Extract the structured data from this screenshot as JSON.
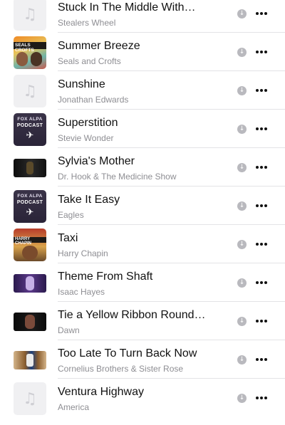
{
  "icons": {
    "download": "download-arrow-circle-icon",
    "more": "more-ellipsis-icon",
    "placeholder": "music-note-icon",
    "podcast_plane": "airplane-icon"
  },
  "colors": {
    "title_text": "#111111",
    "artist_text": "#8e8e93",
    "download_icon": "#b9b9be",
    "separator": "#e3e3e6"
  },
  "songs": [
    {
      "title": "Stuck In The Middle With…",
      "artist": "Stealers Wheel",
      "art": "placeholder"
    },
    {
      "title": "Summer Breeze",
      "artist": "Seals and Crofts",
      "art": "seals",
      "art_text": "SEALS CROFTS"
    },
    {
      "title": "Sunshine",
      "artist": "Jonathan Edwards",
      "art": "placeholder"
    },
    {
      "title": "Superstition",
      "artist": "Stevie Wonder",
      "art": "podcast",
      "art_text_1": "FOX ALPA",
      "art_text_2": "PODCAST"
    },
    {
      "title": "Sylvia's Mother",
      "artist": "Dr. Hook & The Medicine Show",
      "art": "mother"
    },
    {
      "title": "Take It Easy",
      "artist": "Eagles",
      "art": "podcast",
      "art_text_1": "FOX ALPA",
      "art_text_2": "PODCAST"
    },
    {
      "title": "Taxi",
      "artist": "Harry Chapin",
      "art": "chapin",
      "art_text": "HARRY CHAPIN"
    },
    {
      "title": "Theme From Shaft",
      "artist": "Isaac Hayes",
      "art": "shaft"
    },
    {
      "title": "Tie a Yellow Ribbon Round…",
      "artist": "Dawn",
      "art": "dawn"
    },
    {
      "title": "Too Late To Turn Back Now",
      "artist": "Cornelius Brothers & Sister Rose",
      "art": "toolate"
    },
    {
      "title": "Ventura Highway",
      "artist": "America",
      "art": "placeholder"
    }
  ]
}
